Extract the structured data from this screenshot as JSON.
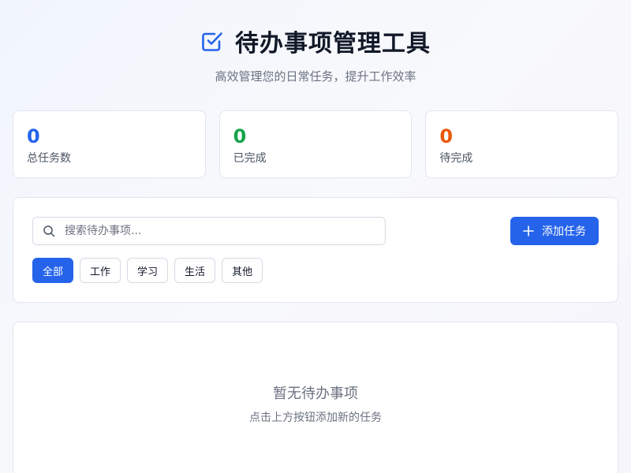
{
  "header": {
    "title": "待办事项管理工具",
    "subtitle": "高效管理您的日常任务，提升工作效率",
    "icon": "checkbox-icon"
  },
  "stats": [
    {
      "value": "0",
      "label": "总任务数",
      "color": "#2563eb"
    },
    {
      "value": "0",
      "label": "已完成",
      "color": "#16a34a"
    },
    {
      "value": "0",
      "label": "待完成",
      "color": "#ea580c"
    }
  ],
  "search": {
    "placeholder": "搜索待办事项...",
    "value": "",
    "icon": "search-icon"
  },
  "add_button": {
    "label": "添加任务",
    "icon": "plus-icon"
  },
  "filters": [
    {
      "label": "全部",
      "active": true
    },
    {
      "label": "工作",
      "active": false
    },
    {
      "label": "学习",
      "active": false
    },
    {
      "label": "生活",
      "active": false
    },
    {
      "label": "其他",
      "active": false
    }
  ],
  "empty_state": {
    "title": "暂无待办事项",
    "description": "点击上方按钮添加新的任务"
  },
  "colors": {
    "accent": "#2563eb",
    "success": "#16a34a",
    "warning": "#ea580c"
  }
}
